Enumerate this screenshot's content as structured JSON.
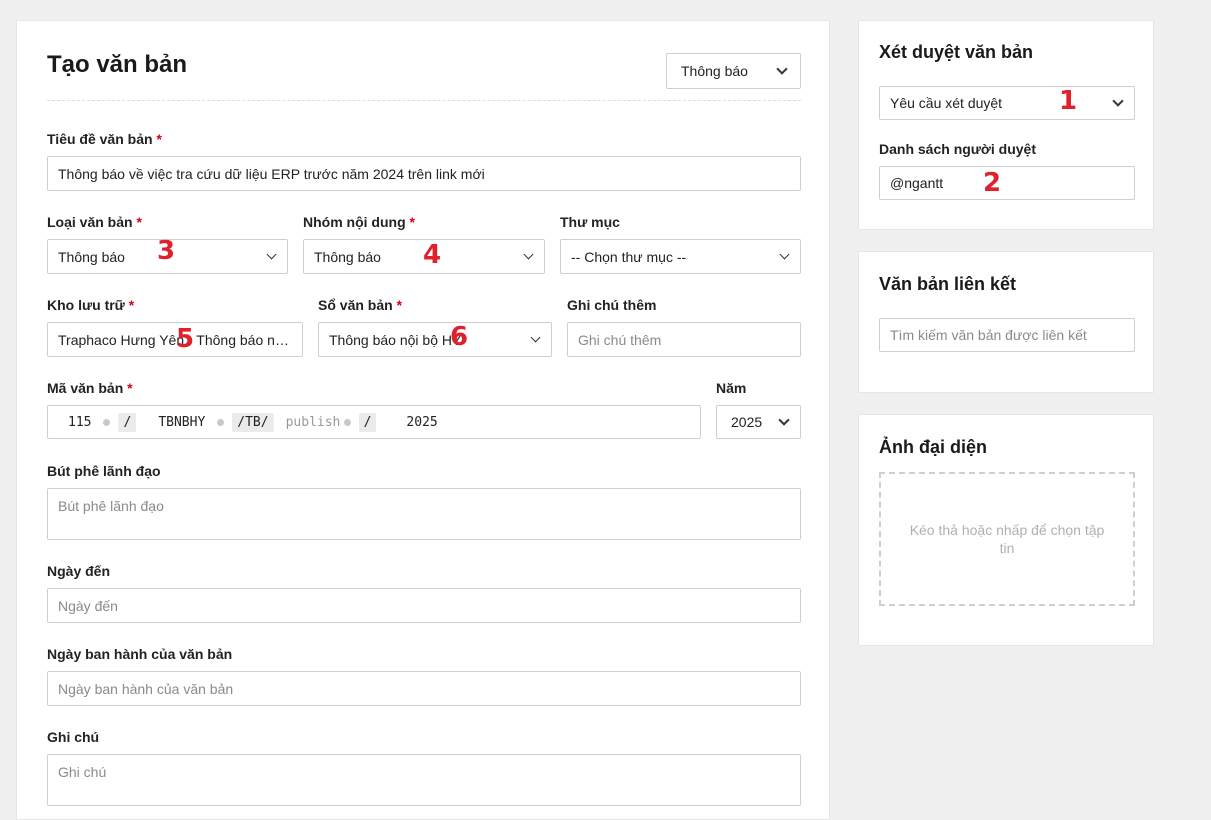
{
  "form": {
    "title": "Tạo văn bản",
    "doc_type_select": "Thông báo",
    "subject_label": "Tiêu đề văn bản",
    "subject_value": "Thông báo về việc tra cứu dữ liệu ERP trước năm 2024 trên link mới",
    "doc_kind_label": "Loại văn bản",
    "doc_kind_value": "Thông báo",
    "content_group_label": "Nhóm nội dung",
    "content_group_value": "Thông báo",
    "folder_label": "Thư mục",
    "folder_value": "-- Chọn thư mục --",
    "storage_label": "Kho lưu trữ",
    "storage_value": "Traphaco Hưng Yên - Thông báo nội bộ",
    "book_label": "Sổ văn bản",
    "book_value": "Thông báo nội bộ HY",
    "extra_note_label": "Ghi chú thêm",
    "extra_note_placeholder": "Ghi chú thêm",
    "code_label": "Mã văn bản",
    "code": {
      "number": "115",
      "sep1": "/",
      "unit": "TBNBHY",
      "sep2": "/TB/",
      "publisher_placeholder": "publisher",
      "sep3": "/",
      "year": "2025"
    },
    "year_label": "Năm",
    "year_value": "2025",
    "leader_note_label": "Bút phê lãnh đạo",
    "leader_note_placeholder": "Bút phê lãnh đạo",
    "arrival_label": "Ngày đến",
    "arrival_placeholder": "Ngày đến",
    "issue_date_label": "Ngày ban hành của văn bản",
    "issue_date_placeholder": "Ngày ban hành của văn bản",
    "note_label": "Ghi chú",
    "note_placeholder": "Ghi chú",
    "required_mark": "*"
  },
  "review": {
    "title": "Xét duyệt văn bản",
    "mode_value": "Yêu cầu xét duyệt",
    "reviewers_label": "Danh sách người duyệt",
    "reviewers_value": "@ngantt"
  },
  "linked": {
    "title": "Văn bản liên kết",
    "search_placeholder": "Tìm kiếm văn bản được liên kết"
  },
  "avatar": {
    "title": "Ảnh đại diện",
    "dropzone_text": "Kéo thả hoặc nhấp để chọn tập tin"
  },
  "annotations": [
    "1",
    "2",
    "3",
    "4",
    "5",
    "6"
  ],
  "colors": {
    "annotation": "#e0202a",
    "required": "#d0021b",
    "background": "#f0f0f0"
  }
}
